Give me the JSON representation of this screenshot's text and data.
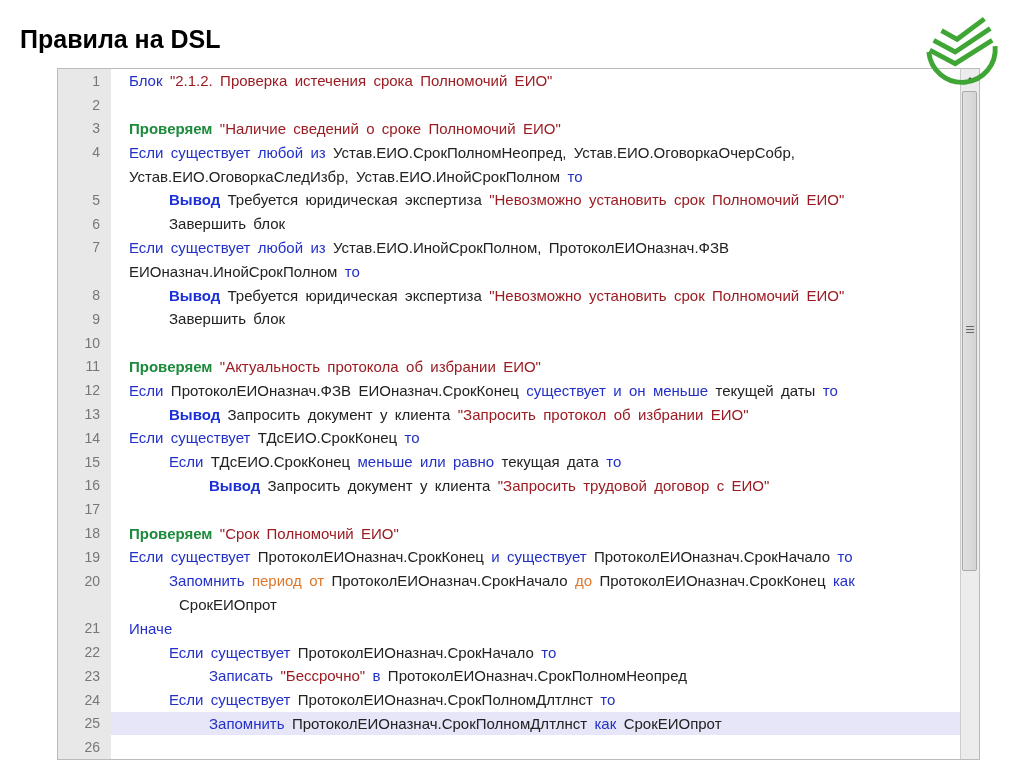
{
  "slide_title": "Правила на DSL",
  "editor": {
    "lines": [
      {
        "number": "1",
        "selected": false,
        "rows": [
          [
            {
              "kind": "keyword",
              "text": "Блок"
            },
            {
              "kind": "string",
              "text": "\"2.1.2. Проверка истечения срока Полномочий ЕИО\""
            }
          ]
        ]
      },
      {
        "number": "2",
        "selected": false
      },
      {
        "number": "3",
        "selected": false,
        "rows": [
          [
            {
              "kind": "check",
              "text": "Проверяем"
            },
            {
              "kind": "string",
              "text": "\"Наличие сведений о сроке Полномочий ЕИО\""
            }
          ]
        ]
      },
      {
        "number": "4",
        "selected": false,
        "rows": [
          [
            {
              "kind": "keyword",
              "text": "Если существует любой из"
            },
            {
              "kind": "plain",
              "text": "Устав.ЕИО.СрокПолномНеопред, Устав.ЕИО.ОговоркаОчерСобр,"
            }
          ],
          [
            {
              "kind": "plain",
              "text": "Устав.ЕИО.ОговоркаСледИзбр, Устав.ЕИО.ИнойСрокПолном"
            },
            {
              "kind": "keyword",
              "text": "то"
            }
          ]
        ],
        "children": [
          {
            "number": "5",
            "selected": false,
            "rows": [
              [
                {
                  "kind": "output",
                  "text": "Вывод"
                },
                {
                  "kind": "plain",
                  "text": "Требуется юридическая экспертиза"
                },
                {
                  "kind": "string",
                  "text": "\"Невозможно установить срок Полномочий ЕИО\""
                }
              ]
            ]
          },
          {
            "number": "6",
            "selected": false,
            "rows": [
              [
                {
                  "kind": "plain",
                  "text": "Завершить блок"
                }
              ]
            ]
          }
        ]
      },
      {
        "number": "7",
        "selected": false,
        "rows": [
          [
            {
              "kind": "keyword",
              "text": "Если существует любой из"
            },
            {
              "kind": "plain",
              "text": "Устав.ЕИО.ИнойСрокПолном, ПротоколЕИОназнач.ФЗВ"
            }
          ],
          [
            {
              "kind": "plain",
              "text": "ЕИОназнач.ИнойСрокПолном"
            },
            {
              "kind": "keyword",
              "text": "то"
            }
          ]
        ],
        "children": [
          {
            "number": "8",
            "selected": false,
            "rows": [
              [
                {
                  "kind": "output",
                  "text": "Вывод"
                },
                {
                  "kind": "plain",
                  "text": "Требуется юридическая экспертиза"
                },
                {
                  "kind": "string",
                  "text": "\"Невозможно установить срок Полномочий ЕИО\""
                }
              ]
            ]
          },
          {
            "number": "9",
            "selected": false,
            "rows": [
              [
                {
                  "kind": "plain",
                  "text": "Завершить блок"
                }
              ]
            ]
          }
        ]
      },
      {
        "number": "10",
        "selected": false
      },
      {
        "number": "11",
        "selected": false,
        "rows": [
          [
            {
              "kind": "check",
              "text": "Проверяем"
            },
            {
              "kind": "string",
              "text": "\"Актуальность протокола об избрании ЕИО\""
            }
          ]
        ]
      },
      {
        "number": "12",
        "selected": false,
        "rows": [
          [
            {
              "kind": "keyword",
              "text": "Если"
            },
            {
              "kind": "plain",
              "text": "ПротоколЕИОназнач.ФЗВ ЕИОназнач.СрокКонец"
            },
            {
              "kind": "keyword",
              "text": "существует и он меньше"
            },
            {
              "kind": "plain",
              "text": "текущей даты"
            },
            {
              "kind": "keyword",
              "text": "то"
            }
          ]
        ],
        "children": [
          {
            "number": "13",
            "selected": false,
            "rows": [
              [
                {
                  "kind": "output",
                  "text": "Вывод"
                },
                {
                  "kind": "plain",
                  "text": "Запросить документ у клиента"
                },
                {
                  "kind": "string",
                  "text": "\"Запросить протокол об избрании ЕИО\""
                }
              ]
            ]
          }
        ]
      },
      {
        "number": "14",
        "selected": false,
        "rows": [
          [
            {
              "kind": "keyword",
              "text": "Если существует"
            },
            {
              "kind": "plain",
              "text": "ТДсЕИО.СрокКонец"
            },
            {
              "kind": "keyword",
              "text": "то"
            }
          ]
        ],
        "children": [
          {
            "number": "15",
            "selected": false,
            "rows": [
              [
                {
                  "kind": "keyword",
                  "text": "Если"
                },
                {
                  "kind": "plain",
                  "text": "ТДсЕИО.СрокКонец"
                },
                {
                  "kind": "keyword",
                  "text": "меньше или равно"
                },
                {
                  "kind": "plain",
                  "text": "текущая дата"
                },
                {
                  "kind": "keyword",
                  "text": "то"
                }
              ]
            ],
            "children": [
              {
                "number": "16",
                "selected": false,
                "rows": [
                  [
                    {
                      "kind": "output",
                      "text": "Вывод"
                    },
                    {
                      "kind": "plain",
                      "text": "Запросить документ у клиента"
                    },
                    {
                      "kind": "string",
                      "text": "\"Запросить трудовой договор с ЕИО\""
                    }
                  ]
                ]
              }
            ]
          }
        ]
      },
      {
        "number": "17",
        "selected": false
      },
      {
        "number": "18",
        "selected": false,
        "rows": [
          [
            {
              "kind": "check",
              "text": "Проверяем"
            },
            {
              "kind": "string",
              "text": "\"Срок Полномочий ЕИО\""
            }
          ]
        ]
      },
      {
        "number": "19",
        "selected": false,
        "rows": [
          [
            {
              "kind": "keyword",
              "text": "Если существует"
            },
            {
              "kind": "plain",
              "text": "ПротоколЕИОназнач.СрокКонец"
            },
            {
              "kind": "keyword",
              "text": "и существует"
            },
            {
              "kind": "plain",
              "text": "ПротоколЕИОназнач.СрокНачало"
            },
            {
              "kind": "keyword",
              "text": "то"
            }
          ]
        ],
        "children": [
          {
            "number": "20",
            "selected": false,
            "rows": [
              [
                {
                  "kind": "keyword",
                  "text": "Запомнить"
                },
                {
                  "kind": "range",
                  "text": "период от"
                },
                {
                  "kind": "plain",
                  "text": "ПротоколЕИОназнач.СрокНачало"
                },
                {
                  "kind": "range",
                  "text": "до"
                },
                {
                  "kind": "plain",
                  "text": "ПротоколЕИОназнач.СрокКонец"
                },
                {
                  "kind": "keyword",
                  "text": "как"
                }
              ],
              [
                {
                  "kind": "plain",
                  "text": "СрокЕИОпрот"
                }
              ]
            ]
          }
        ]
      },
      {
        "number": "21",
        "selected": false,
        "rows": [
          [
            {
              "kind": "keyword",
              "text": "Иначе"
            }
          ]
        ],
        "children": [
          {
            "number": "22",
            "selected": false,
            "rows": [
              [
                {
                  "kind": "keyword",
                  "text": "Если существует"
                },
                {
                  "kind": "plain",
                  "text": "ПротоколЕИОназнач.СрокНачало"
                },
                {
                  "kind": "keyword",
                  "text": "то"
                }
              ]
            ],
            "children": [
              {
                "number": "23",
                "selected": false,
                "rows": [
                  [
                    {
                      "kind": "keyword",
                      "text": "Записать"
                    },
                    {
                      "kind": "string",
                      "text": "\"Бессрочно\""
                    },
                    {
                      "kind": "keyword",
                      "text": "в"
                    },
                    {
                      "kind": "plain",
                      "text": "ПротоколЕИОназнач.СрокПолномНеопред"
                    }
                  ]
                ]
              }
            ]
          },
          {
            "number": "24",
            "selected": false,
            "rows": [
              [
                {
                  "kind": "keyword",
                  "text": "Если существует"
                },
                {
                  "kind": "plain",
                  "text": "ПротоколЕИОназнач.СрокПолномДлтлнст"
                },
                {
                  "kind": "keyword",
                  "text": "то"
                }
              ]
            ],
            "children": [
              {
                "number": "25",
                "selected": true,
                "rows": [
                  [
                    {
                      "kind": "keyword",
                      "text": "Запомнить"
                    },
                    {
                      "kind": "plain",
                      "text": "ПротоколЕИОназнач.СрокПолномДлтлнст"
                    },
                    {
                      "kind": "keyword",
                      "text": "как"
                    },
                    {
                      "kind": "plain",
                      "text": "СрокЕИОпрот"
                    }
                  ]
                ]
              }
            ]
          }
        ]
      },
      {
        "number": "26",
        "selected": false
      }
    ]
  }
}
